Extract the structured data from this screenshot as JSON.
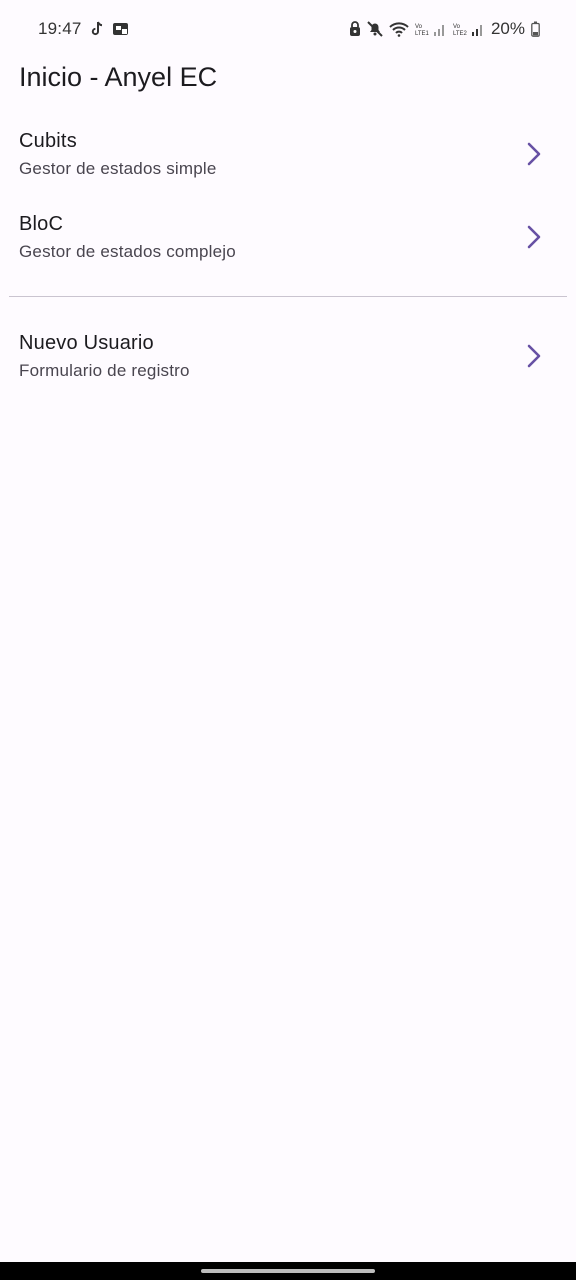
{
  "status_bar": {
    "time": "19:47",
    "battery": "20%",
    "icons_left": [
      "tiktok-icon",
      "notification-app-icon"
    ],
    "icons_right": [
      "lock-icon",
      "mute-icon",
      "wifi-icon",
      "signal-lte1-icon",
      "signal-lte2-icon",
      "battery-icon"
    ]
  },
  "header": {
    "title": "Inicio - Anyel EC"
  },
  "list": {
    "items": [
      {
        "title": "Cubits",
        "subtitle": "Gestor de estados simple"
      },
      {
        "title": "BloC",
        "subtitle": "Gestor de estados complejo"
      },
      {
        "title": "Nuevo Usuario",
        "subtitle": "Formulario de registro"
      }
    ]
  },
  "colors": {
    "background": "#fefbff",
    "accent": "#6750a4",
    "divider": "#cac4d0"
  }
}
